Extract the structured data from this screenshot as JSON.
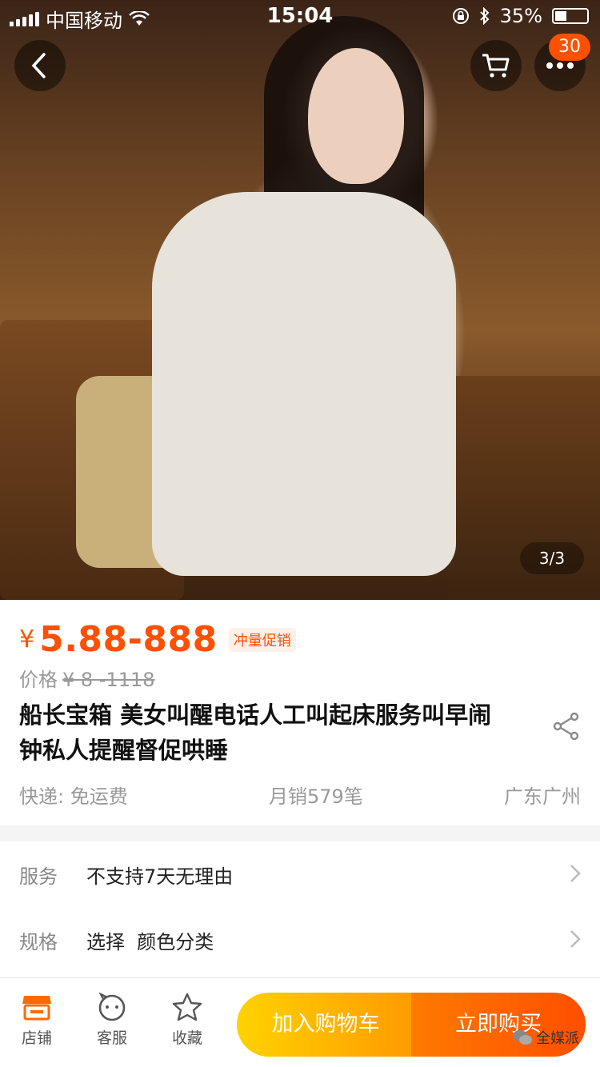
{
  "status_bar": {
    "carrier": "中国移动",
    "time": "15:04",
    "battery": "35%"
  },
  "header": {
    "cart_badge": "30"
  },
  "gallery": {
    "counter": "3/3"
  },
  "product": {
    "currency": "¥",
    "price": "5.88-888",
    "promo_tag": "冲量促销",
    "original_label": "价格",
    "original_price": "¥ 8 -1118",
    "title": "船长宝箱 美女叫醒电话人工叫起床服务叫早闹钟私人提醒督促哄睡",
    "shipping": "快递: 免运费",
    "monthly_sales": "月销579笔",
    "location": "广东广州"
  },
  "options": [
    {
      "label": "服务",
      "value": "不支持7天无理由"
    },
    {
      "label": "规格",
      "value": "选择  颜色分类"
    }
  ],
  "tabbar": {
    "shop": "店铺",
    "service": "客服",
    "favorite": "收藏",
    "add_to_cart": "加入购物车",
    "buy_now": "立即购买"
  },
  "watermark": "全媒派",
  "colors": {
    "accent": "#ff5000",
    "cart_button": "#ffb000",
    "buy_button": "#ff5a00"
  }
}
